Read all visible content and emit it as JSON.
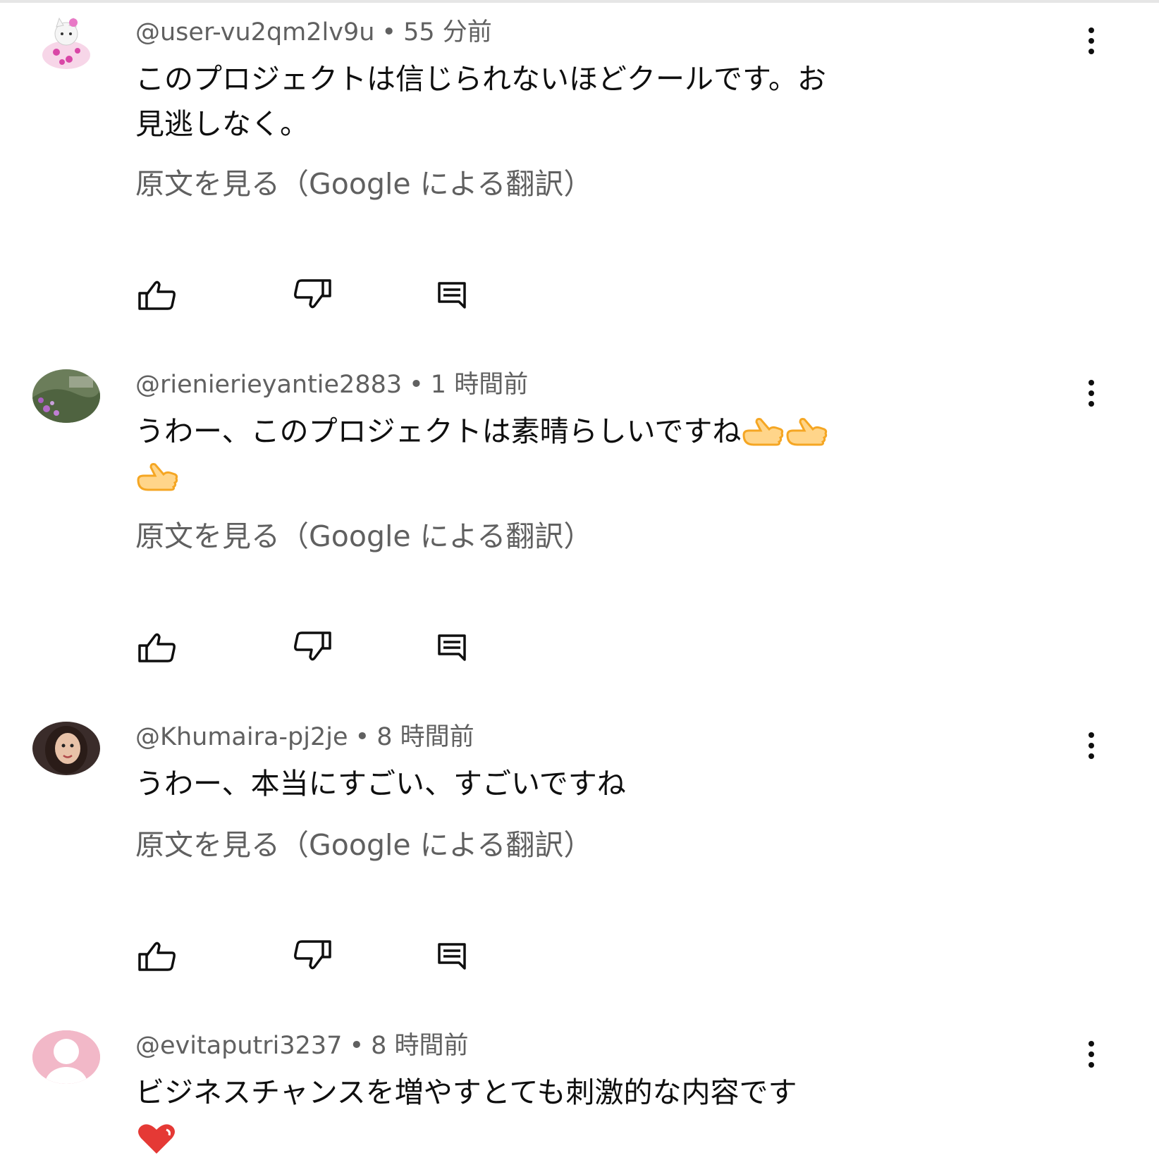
{
  "comments": [
    {
      "handle": "@user-vu2qm2lv9u",
      "separator": "•",
      "time": "55 分前",
      "text_line1": "このプロジェクトは信じられないほどクールです。お",
      "text_line2": "見逃しなく。",
      "translate": "原文を見る（Google による翻訳）",
      "avatar_icon": "cat-avatar-icon"
    },
    {
      "handle": "@rienierieyantie2883",
      "separator": "•",
      "time": "1 時間前",
      "text_line1": "うわー、このプロジェクトは素晴らしいですね",
      "emoji": "👍👍👍",
      "translate": "原文を見る（Google による翻訳）",
      "avatar_icon": "garden-photo-avatar-icon"
    },
    {
      "handle": "@Khumaira-pj2je",
      "separator": "•",
      "time": "8 時間前",
      "text_line1": "うわー、本当にすごい、すごいですね",
      "translate": "原文を見る（Google による翻訳）",
      "avatar_icon": "portrait-avatar-icon"
    },
    {
      "handle": "@evitaputri3237",
      "separator": "•",
      "time": "8 時間前",
      "text_line1": "ビジネスチャンスを増やすとても刺激的な内容です",
      "emoji": "❤️",
      "translate": "",
      "avatar_icon": "default-avatar-icon"
    }
  ],
  "colors": {
    "text": "#0f0f0f",
    "meta": "#606060",
    "emoji_thumb": "#f5a623",
    "heart": "#e53935"
  }
}
